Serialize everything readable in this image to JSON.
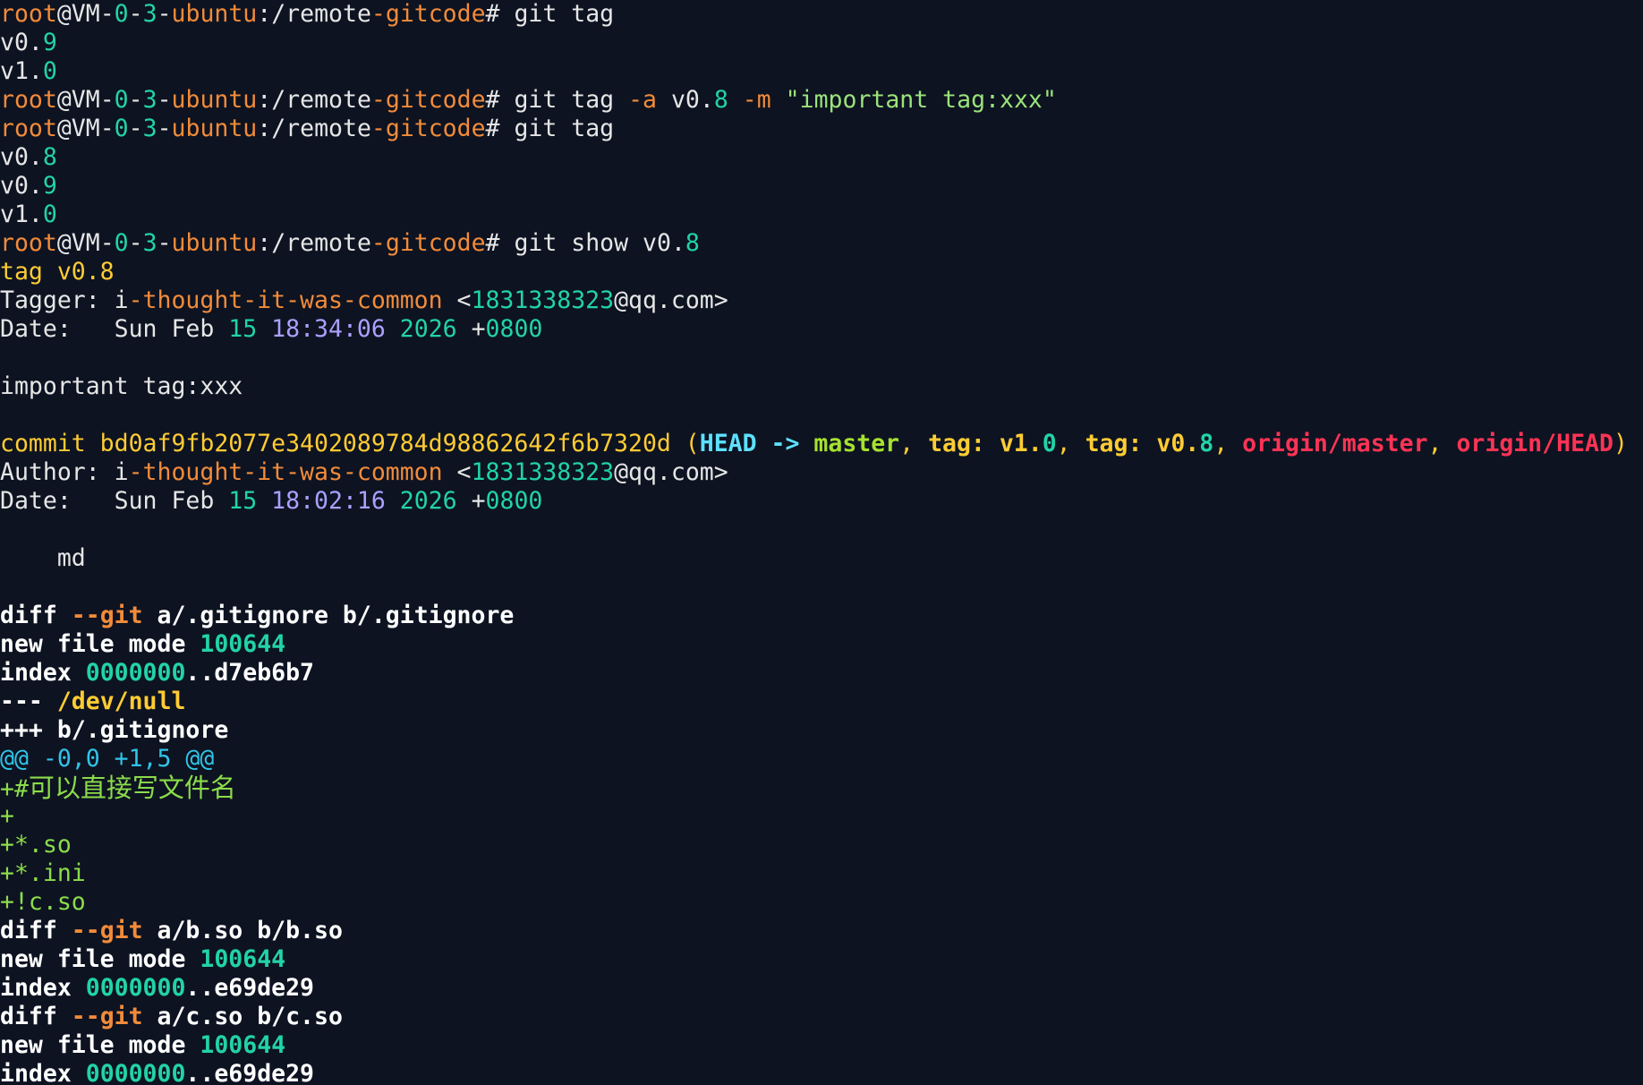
{
  "window": {
    "type": "terminal",
    "background": "#0d1321"
  },
  "colors": {
    "default": "#e6e6e6",
    "white": "#ffffff",
    "orange": "#f28b3a",
    "teal": "#22d3a6",
    "lavender": "#a9a1ff",
    "green": "#8bdc4b",
    "yellow": "#ffcc33",
    "red": "#ff3355",
    "cyan": "#31c4e8",
    "head_cyan": "#5ce1ff",
    "string_green": "#9be37a",
    "light_green": "#a6e22e"
  },
  "terminal": {
    "lines": [
      {
        "segments": [
          {
            "t": "root",
            "c": "orange"
          },
          {
            "t": "@VM-",
            "c": "default"
          },
          {
            "t": "0",
            "c": "teal"
          },
          {
            "t": "-",
            "c": "default"
          },
          {
            "t": "3",
            "c": "teal"
          },
          {
            "t": "-",
            "c": "default"
          },
          {
            "t": "ubuntu",
            "c": "orange"
          },
          {
            "t": ":/remote",
            "c": "default"
          },
          {
            "t": "-gitcode",
            "c": "orange"
          },
          {
            "t": "# git tag",
            "c": "default"
          }
        ]
      },
      {
        "segments": [
          {
            "t": "v0.",
            "c": "default"
          },
          {
            "t": "9",
            "c": "teal"
          }
        ]
      },
      {
        "segments": [
          {
            "t": "v1.",
            "c": "default"
          },
          {
            "t": "0",
            "c": "teal"
          }
        ]
      },
      {
        "segments": [
          {
            "t": "root",
            "c": "orange"
          },
          {
            "t": "@VM-",
            "c": "default"
          },
          {
            "t": "0",
            "c": "teal"
          },
          {
            "t": "-",
            "c": "default"
          },
          {
            "t": "3",
            "c": "teal"
          },
          {
            "t": "-",
            "c": "default"
          },
          {
            "t": "ubuntu",
            "c": "orange"
          },
          {
            "t": ":/remote",
            "c": "default"
          },
          {
            "t": "-gitcode",
            "c": "orange"
          },
          {
            "t": "# git tag ",
            "c": "default"
          },
          {
            "t": "-a",
            "c": "orange"
          },
          {
            "t": " v0.",
            "c": "default"
          },
          {
            "t": "8",
            "c": "teal"
          },
          {
            "t": " ",
            "c": "default"
          },
          {
            "t": "-m",
            "c": "orange"
          },
          {
            "t": " ",
            "c": "default"
          },
          {
            "t": "\"important tag:xxx\"",
            "c": "string_green"
          }
        ]
      },
      {
        "segments": [
          {
            "t": "root",
            "c": "orange"
          },
          {
            "t": "@VM-",
            "c": "default"
          },
          {
            "t": "0",
            "c": "teal"
          },
          {
            "t": "-",
            "c": "default"
          },
          {
            "t": "3",
            "c": "teal"
          },
          {
            "t": "-",
            "c": "default"
          },
          {
            "t": "ubuntu",
            "c": "orange"
          },
          {
            "t": ":/remote",
            "c": "default"
          },
          {
            "t": "-gitcode",
            "c": "orange"
          },
          {
            "t": "# git tag",
            "c": "default"
          }
        ]
      },
      {
        "segments": [
          {
            "t": "v0.",
            "c": "default"
          },
          {
            "t": "8",
            "c": "teal"
          }
        ]
      },
      {
        "segments": [
          {
            "t": "v0.",
            "c": "default"
          },
          {
            "t": "9",
            "c": "teal"
          }
        ]
      },
      {
        "segments": [
          {
            "t": "v1.",
            "c": "default"
          },
          {
            "t": "0",
            "c": "teal"
          }
        ]
      },
      {
        "segments": [
          {
            "t": "root",
            "c": "orange"
          },
          {
            "t": "@VM-",
            "c": "default"
          },
          {
            "t": "0",
            "c": "teal"
          },
          {
            "t": "-",
            "c": "default"
          },
          {
            "t": "3",
            "c": "teal"
          },
          {
            "t": "-",
            "c": "default"
          },
          {
            "t": "ubuntu",
            "c": "orange"
          },
          {
            "t": ":/remote",
            "c": "default"
          },
          {
            "t": "-gitcode",
            "c": "orange"
          },
          {
            "t": "# git show v0.",
            "c": "default"
          },
          {
            "t": "8",
            "c": "teal"
          }
        ]
      },
      {
        "segments": [
          {
            "t": "tag v0.8",
            "c": "yellow"
          }
        ]
      },
      {
        "segments": [
          {
            "t": "Tagger: i",
            "c": "default"
          },
          {
            "t": "-thought-it-was-common",
            "c": "orange"
          },
          {
            "t": " <",
            "c": "default"
          },
          {
            "t": "1831338323",
            "c": "teal"
          },
          {
            "t": "@qq.com>",
            "c": "default"
          }
        ]
      },
      {
        "segments": [
          {
            "t": "Date:   Sun Feb ",
            "c": "default"
          },
          {
            "t": "15",
            "c": "teal"
          },
          {
            "t": " ",
            "c": "default"
          },
          {
            "t": "18:34:06",
            "c": "lavender"
          },
          {
            "t": " ",
            "c": "default"
          },
          {
            "t": "2026",
            "c": "teal"
          },
          {
            "t": " +",
            "c": "default"
          },
          {
            "t": "0800",
            "c": "teal"
          }
        ]
      },
      {
        "segments": [
          {
            "t": "",
            "c": "default"
          }
        ]
      },
      {
        "segments": [
          {
            "t": "important tag:xxx",
            "c": "default"
          }
        ]
      },
      {
        "segments": [
          {
            "t": "",
            "c": "default"
          }
        ]
      },
      {
        "segments": [
          {
            "t": "commit bd0af9fb2077e3402089784d98862642f6b7320d (",
            "c": "yellow"
          },
          {
            "t": "HEAD -> ",
            "c": "head_cyan",
            "b": true
          },
          {
            "t": "master",
            "c": "light_green",
            "b": true
          },
          {
            "t": ", ",
            "c": "yellow"
          },
          {
            "t": "tag: v1.",
            "c": "yellow",
            "b": true
          },
          {
            "t": "0",
            "c": "teal",
            "b": true
          },
          {
            "t": ", ",
            "c": "yellow"
          },
          {
            "t": "tag: v0.",
            "c": "yellow",
            "b": true
          },
          {
            "t": "8",
            "c": "teal",
            "b": true
          },
          {
            "t": ", ",
            "c": "yellow"
          },
          {
            "t": "origin/master",
            "c": "red",
            "b": true
          },
          {
            "t": ", ",
            "c": "yellow"
          },
          {
            "t": "origin/HEAD",
            "c": "red",
            "b": true
          },
          {
            "t": ")",
            "c": "yellow"
          }
        ]
      },
      {
        "segments": [
          {
            "t": "Author: i",
            "c": "default"
          },
          {
            "t": "-thought-it-was-common",
            "c": "orange"
          },
          {
            "t": " <",
            "c": "default"
          },
          {
            "t": "1831338323",
            "c": "teal"
          },
          {
            "t": "@qq.com>",
            "c": "default"
          }
        ]
      },
      {
        "segments": [
          {
            "t": "Date:   Sun Feb ",
            "c": "default"
          },
          {
            "t": "15",
            "c": "teal"
          },
          {
            "t": " ",
            "c": "default"
          },
          {
            "t": "18:02:16",
            "c": "lavender"
          },
          {
            "t": " ",
            "c": "default"
          },
          {
            "t": "2026",
            "c": "teal"
          },
          {
            "t": " +",
            "c": "default"
          },
          {
            "t": "0800",
            "c": "teal"
          }
        ]
      },
      {
        "segments": [
          {
            "t": "",
            "c": "default"
          }
        ]
      },
      {
        "segments": [
          {
            "t": "    md",
            "c": "default"
          }
        ]
      },
      {
        "segments": [
          {
            "t": "",
            "c": "default"
          }
        ]
      },
      {
        "segments": [
          {
            "t": "diff ",
            "c": "white",
            "b": true
          },
          {
            "t": "--git",
            "c": "orange",
            "b": true
          },
          {
            "t": " a/.gitignore b/.gitignore",
            "c": "white",
            "b": true
          }
        ]
      },
      {
        "segments": [
          {
            "t": "new file mode ",
            "c": "white",
            "b": true
          },
          {
            "t": "100644",
            "c": "teal",
            "b": true
          }
        ]
      },
      {
        "segments": [
          {
            "t": "index ",
            "c": "white",
            "b": true
          },
          {
            "t": "0000000",
            "c": "teal",
            "b": true
          },
          {
            "t": "..d7eb6b7",
            "c": "white",
            "b": true
          }
        ]
      },
      {
        "segments": [
          {
            "t": "--- ",
            "c": "white",
            "b": true
          },
          {
            "t": "/dev/null",
            "c": "yellow",
            "b": true
          }
        ]
      },
      {
        "segments": [
          {
            "t": "+++ b/.gitignore",
            "c": "white",
            "b": true
          }
        ]
      },
      {
        "segments": [
          {
            "t": "@@ -0,0 +1,5 @@",
            "c": "cyan"
          }
        ]
      },
      {
        "segments": [
          {
            "t": "+#",
            "c": "green"
          },
          {
            "t": "可以直接写文件名",
            "c": "green",
            "w": true
          }
        ]
      },
      {
        "segments": [
          {
            "t": "+",
            "c": "green"
          }
        ]
      },
      {
        "segments": [
          {
            "t": "+*.so",
            "c": "green"
          }
        ]
      },
      {
        "segments": [
          {
            "t": "+*.ini",
            "c": "green"
          }
        ]
      },
      {
        "segments": [
          {
            "t": "+!c.so",
            "c": "green"
          }
        ]
      },
      {
        "segments": [
          {
            "t": "diff ",
            "c": "white",
            "b": true
          },
          {
            "t": "--git",
            "c": "orange",
            "b": true
          },
          {
            "t": " a/b.so b/b.so",
            "c": "white",
            "b": true
          }
        ]
      },
      {
        "segments": [
          {
            "t": "new file mode ",
            "c": "white",
            "b": true
          },
          {
            "t": "100644",
            "c": "teal",
            "b": true
          }
        ]
      },
      {
        "segments": [
          {
            "t": "index ",
            "c": "white",
            "b": true
          },
          {
            "t": "0000000",
            "c": "teal",
            "b": true
          },
          {
            "t": "..e69de29",
            "c": "white",
            "b": true
          }
        ]
      },
      {
        "segments": [
          {
            "t": "diff ",
            "c": "white",
            "b": true
          },
          {
            "t": "--git",
            "c": "orange",
            "b": true
          },
          {
            "t": " a/c.so b/c.so",
            "c": "white",
            "b": true
          }
        ]
      },
      {
        "segments": [
          {
            "t": "new file mode ",
            "c": "white",
            "b": true
          },
          {
            "t": "100644",
            "c": "teal",
            "b": true
          }
        ]
      },
      {
        "segments": [
          {
            "t": "index ",
            "c": "white",
            "b": true
          },
          {
            "t": "0000000",
            "c": "teal",
            "b": true
          },
          {
            "t": "..e69de29",
            "c": "white",
            "b": true
          }
        ]
      }
    ]
  }
}
